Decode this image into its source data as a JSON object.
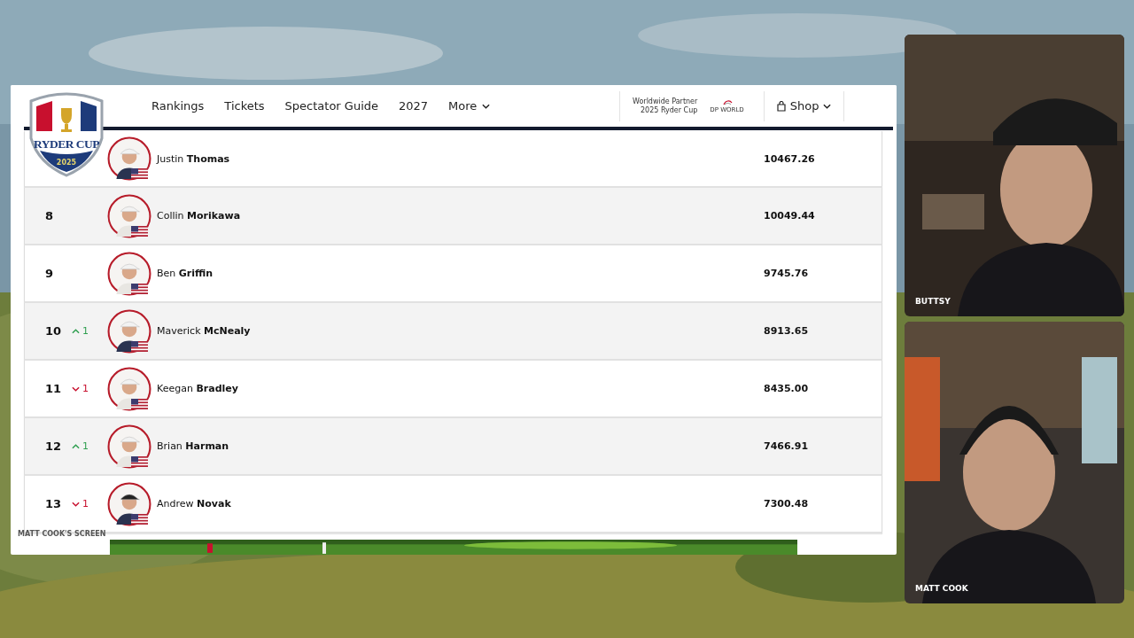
{
  "site_header": {
    "logo": {
      "title": "RYDER CUP",
      "year": "2025"
    },
    "nav": [
      {
        "label": "Rankings",
        "dropdown": false
      },
      {
        "label": "Tickets",
        "dropdown": false
      },
      {
        "label": "Spectator Guide",
        "dropdown": false
      },
      {
        "label": "2027",
        "dropdown": false
      },
      {
        "label": "More",
        "dropdown": true
      }
    ],
    "partner": {
      "line_1": "Worldwide Partner",
      "line_2": "2025 Ryder Cup",
      "logo_text": "DP WORLD"
    },
    "shop": {
      "label": "Shop"
    }
  },
  "rankings": [
    {
      "first": "Justin",
      "last": "Thomas",
      "points": "10467.26"
    },
    {
      "rank": "8",
      "first": "Collin",
      "last": "Morikawa",
      "points": "10049.44"
    },
    {
      "rank": "9",
      "first": "Ben",
      "last": "Griffin",
      "points": "9745.76"
    },
    {
      "rank": "10",
      "rising": true,
      "change": "1",
      "first": "Maverick",
      "last": "McNealy",
      "points": "8913.65"
    },
    {
      "rank": "11",
      "rising": false,
      "change": "1",
      "first": "Keegan",
      "last": "Bradley",
      "points": "8435.00"
    },
    {
      "rank": "12",
      "rising": true,
      "change": "1",
      "first": "Brian",
      "last": "Harman",
      "points": "7466.91"
    },
    {
      "rank": "13",
      "rising": false,
      "change": "1",
      "first": "Andrew",
      "last": "Novak",
      "points": "7300.48"
    }
  ],
  "screen_label": "MATT COOK'S SCREEN",
  "cameras": [
    {
      "name": "BUTTSY"
    },
    {
      "name": "MATT COOK"
    }
  ]
}
